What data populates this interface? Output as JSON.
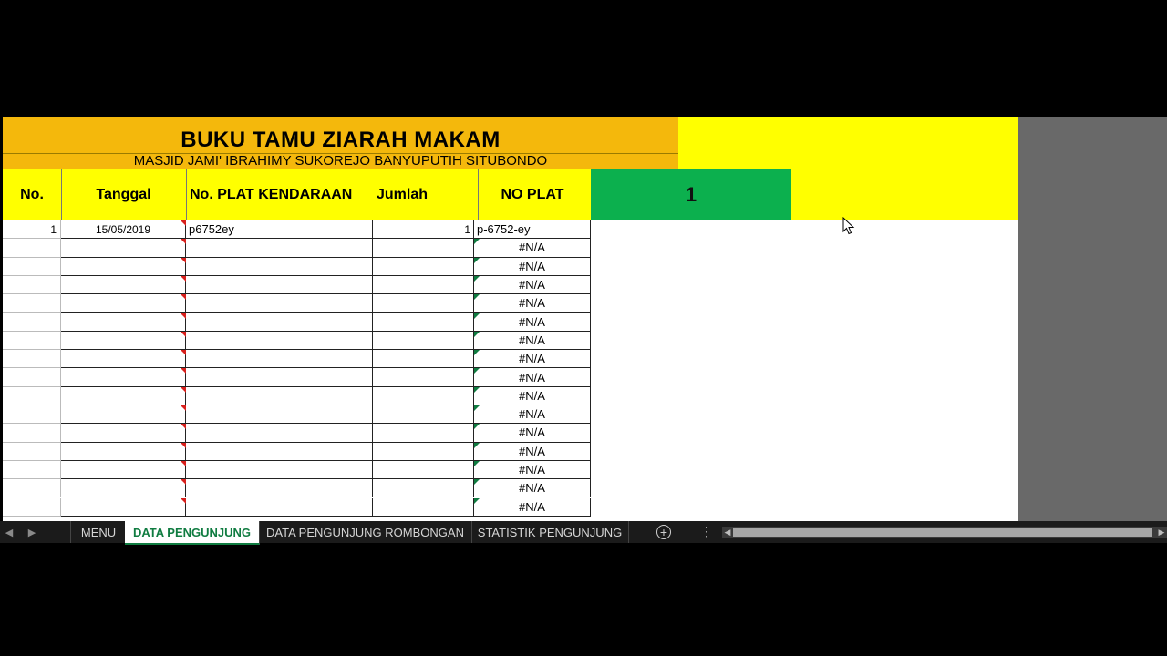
{
  "sheet": {
    "title": "BUKU TAMU ZIARAH MAKAM",
    "subtitle": "MASJID JAMI' IBRAHIMY SUKOREJO BANYUPUTIH SITUBONDO",
    "headers": {
      "no": "No.",
      "tanggal": "Tanggal",
      "plat": "No. PLAT KENDARAAN",
      "jumlah": "Jumlah",
      "no_plat": "NO PLAT"
    },
    "counter": "1",
    "rows": [
      {
        "no": "1",
        "tanggal": "15/05/2019",
        "plat": "p6752ey",
        "jumlah": "1",
        "no_plat": "p-6752-ey"
      },
      {
        "no": "",
        "tanggal": "",
        "plat": "",
        "jumlah": "",
        "no_plat": "#N/A"
      },
      {
        "no": "",
        "tanggal": "",
        "plat": "",
        "jumlah": "",
        "no_plat": "#N/A"
      },
      {
        "no": "",
        "tanggal": "",
        "plat": "",
        "jumlah": "",
        "no_plat": "#N/A"
      },
      {
        "no": "",
        "tanggal": "",
        "plat": "",
        "jumlah": "",
        "no_plat": "#N/A"
      },
      {
        "no": "",
        "tanggal": "",
        "plat": "",
        "jumlah": "",
        "no_plat": "#N/A"
      },
      {
        "no": "",
        "tanggal": "",
        "plat": "",
        "jumlah": "",
        "no_plat": "#N/A"
      },
      {
        "no": "",
        "tanggal": "",
        "plat": "",
        "jumlah": "",
        "no_plat": "#N/A"
      },
      {
        "no": "",
        "tanggal": "",
        "plat": "",
        "jumlah": "",
        "no_plat": "#N/A"
      },
      {
        "no": "",
        "tanggal": "",
        "plat": "",
        "jumlah": "",
        "no_plat": "#N/A"
      },
      {
        "no": "",
        "tanggal": "",
        "plat": "",
        "jumlah": "",
        "no_plat": "#N/A"
      },
      {
        "no": "",
        "tanggal": "",
        "plat": "",
        "jumlah": "",
        "no_plat": "#N/A"
      },
      {
        "no": "",
        "tanggal": "",
        "plat": "",
        "jumlah": "",
        "no_plat": "#N/A"
      },
      {
        "no": "",
        "tanggal": "",
        "plat": "",
        "jumlah": "",
        "no_plat": "#N/A"
      },
      {
        "no": "",
        "tanggal": "",
        "plat": "",
        "jumlah": "",
        "no_plat": "#N/A"
      },
      {
        "no": "",
        "tanggal": "",
        "plat": "",
        "jumlah": "",
        "no_plat": "#N/A"
      }
    ]
  },
  "tabs": [
    {
      "label": "MENU",
      "active": false
    },
    {
      "label": "DATA PENGUNJUNG",
      "active": true
    },
    {
      "label": "DATA PENGUNJUNG ROMBONGAN",
      "active": false
    },
    {
      "label": "STATISTIK PENGUNJUNG",
      "active": false
    }
  ],
  "icons": {
    "add_sheet": "plus-circle-icon",
    "more": "vertical-ellipsis-icon",
    "cursor": "mouse-pointer-icon"
  },
  "colors": {
    "title_band": "#f4b80c",
    "header_yellow": "#ffff00",
    "counter_green": "#0cb04e",
    "active_tab_text": "#107c41"
  }
}
